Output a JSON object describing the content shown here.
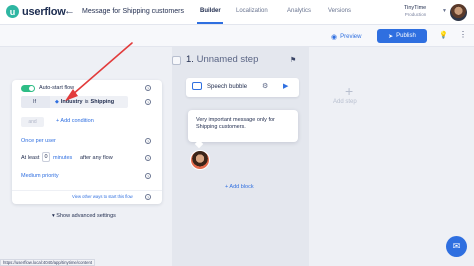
{
  "brand": {
    "logo_mark": "u",
    "logo_text": "userflow"
  },
  "header": {
    "back_icon": "arrow-left-icon",
    "flow_title": "Message for Shipping customers",
    "tabs": [
      {
        "label": "Builder",
        "active": true
      },
      {
        "label": "Localization",
        "active": false
      },
      {
        "label": "Analytics",
        "active": false
      },
      {
        "label": "Versions",
        "active": false
      }
    ],
    "account": {
      "name": "TinyTime",
      "environment": "Production"
    }
  },
  "toolbar": {
    "preview_label": "Preview",
    "publish_label": "Publish",
    "accent_color": "#2f6fe0"
  },
  "start_settings": {
    "auto_start_label": "Auto-start flow",
    "auto_start_enabled": true,
    "if_label": "If",
    "condition": {
      "attribute": "Industry",
      "operator": "is",
      "value": "Shipping"
    },
    "and_label": "and",
    "add_condition_label": "+ Add condition",
    "frequency_label": "Once per user",
    "atleast_label": "At least",
    "atleast_value": "0",
    "minutes_label": "minutes",
    "after_label": "after any flow",
    "priority_label": "Medium priority",
    "other_ways_link": "View other ways to start this flow",
    "show_advanced_label": "Show advanced settings"
  },
  "step": {
    "number": "1.",
    "name": "Unnamed step",
    "block": {
      "type_label": "Speech bubble"
    },
    "bubble_message": "Very important message only for Shipping customers.",
    "add_block_label": "+ Add block"
  },
  "add_step_plus": "+",
  "add_step_label": "Add step",
  "status_url": "https://userflow.local:4040/app/tinytime/content"
}
